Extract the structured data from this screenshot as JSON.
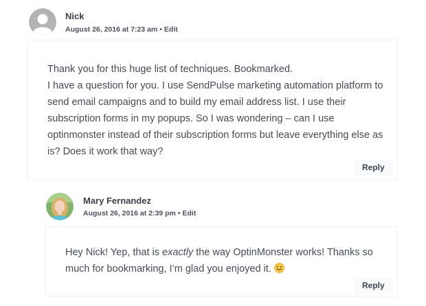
{
  "comments": [
    {
      "author": "Nick",
      "date": "August 26, 2016 at 7:23 am",
      "separator": "•",
      "edit_label": "Edit",
      "body_lines": [
        "Thank you for this huge list of techniques. Bookmarked.",
        "I have a question for you. I use SendPulse marketing automation platform to send email campaigns and to build my email address list. I use their subscription forms in my popups. So I was wondering – can I use optinmonster instead of their subscription forms but leave everything else as is? Does it work that way?"
      ],
      "reply_label": "Reply",
      "avatar_icon": "default-user-avatar-icon"
    },
    {
      "author": "Mary Fernandez",
      "date": "August 26, 2016 at 2:39 pm",
      "separator": "•",
      "edit_label": "Edit",
      "body_before": "Hey Nick! Yep, that is ",
      "body_emphasis": "exactly",
      "body_after": " the way OptinMonster works! Thanks so much for bookmarking, I’m glad you enjoyed it. ",
      "emoji_icon": "smiley-emoji-icon",
      "reply_label": "Reply",
      "avatar_icon": "user-photo-avatar"
    }
  ],
  "colors": {
    "text": "#454b55",
    "author": "#3a3f48",
    "box_border": "#f3f4f6",
    "reply_bg": "#f9fafb"
  }
}
